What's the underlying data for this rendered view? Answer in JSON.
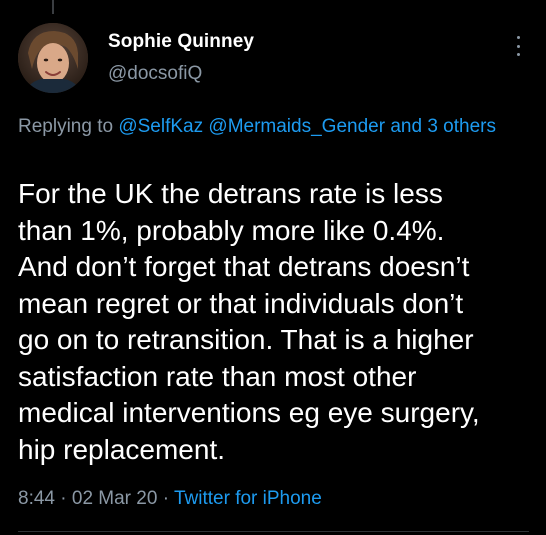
{
  "tweet": {
    "author": {
      "display_name": "Sophie Quinney",
      "handle": "@docsofiQ"
    },
    "replying": {
      "prefix": "Replying to",
      "mentions": [
        "@SelfKaz",
        "@Mermaids_Gender"
      ],
      "joiner": "and",
      "others_link": "3 others"
    },
    "text": "For the UK the detrans rate is less\nthan 1%, probably more like 0.4%.\nAnd don’t forget that detrans doesn’t\nmean regret or that individuals don’t\ngo on to retransition. That is a higher\nsatisfaction rate than most other\nmedical interventions eg eye surgery,\nhip replacement.",
    "meta": {
      "time": "8:44",
      "separator": "·",
      "date": "02 Mar 20",
      "source": "Twitter for iPhone"
    }
  },
  "icons": {
    "more": "more-vertical-icon"
  },
  "colors": {
    "background": "#000000",
    "primary_text": "#ffffff",
    "secondary_text": "#8b98a5",
    "link": "#1d9bf0",
    "divider": "#2f3336"
  }
}
